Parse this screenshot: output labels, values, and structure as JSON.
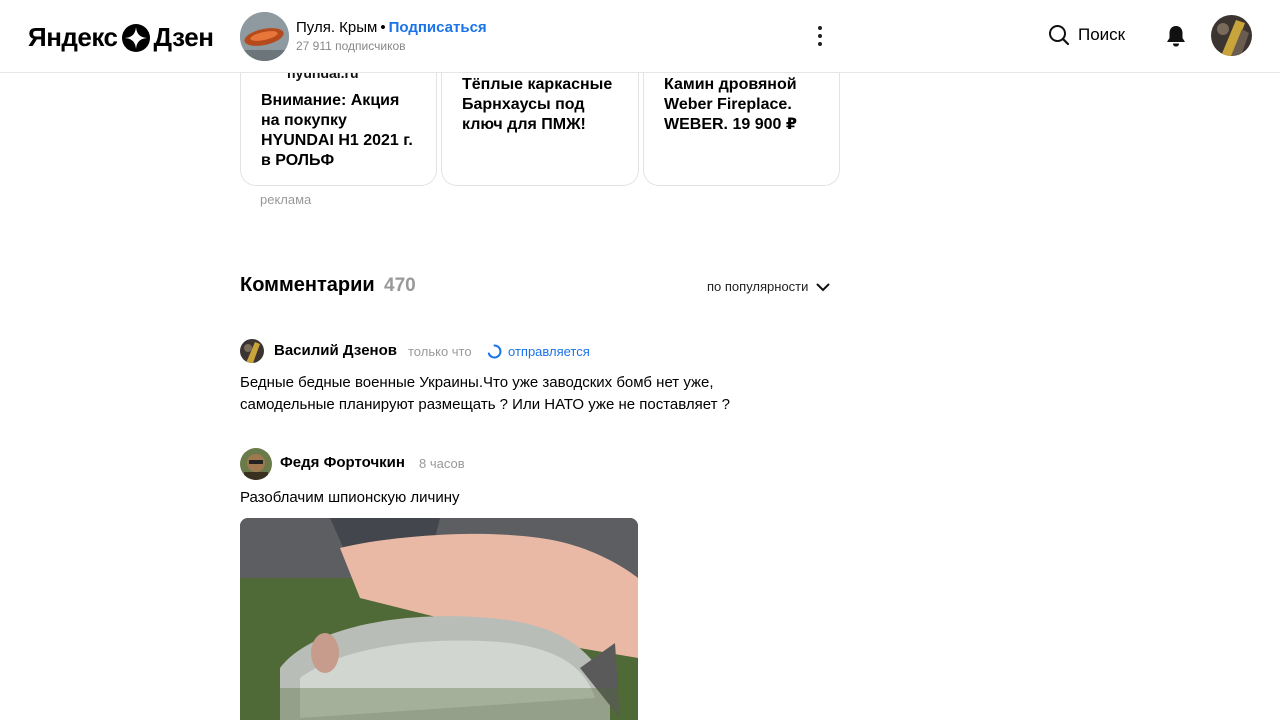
{
  "header": {
    "logo_text_left": "Яндекс",
    "logo_text_right": "Дзен",
    "channel_name": "Пуля. Крым",
    "channel_dot": "•",
    "subscribe_label": "Подписаться",
    "subscribers": "27 911 подписчиков",
    "search_label": "Поиск"
  },
  "ads": {
    "cards": [
      {
        "domain": "hyundai.ru",
        "title": "Внимание: Акция на покупку HYUNDAI H1 2021 г. в РОЛЬФ"
      },
      {
        "title": "Тёплые каркасные Барнхаусы под ключ для ПМЖ!"
      },
      {
        "title": "Камин дровяной Weber Fireplace. WEBER. 19 900 ₽"
      }
    ],
    "label": "реклама"
  },
  "comments": {
    "title": "Комментарии",
    "count": "470",
    "sort_label": "по популярности",
    "items": [
      {
        "author": "Василий Дзенов",
        "time": "только что",
        "status": "отправляется",
        "text": "Бедные бедные военные Украины.Что уже заводских бомб нет уже, самодельные планируют размещать ? Или НАТО уже не поставляет ?"
      },
      {
        "author": "Федя Форточкин",
        "time": "8 часов",
        "text": "Разоблачим шпионскую личину"
      }
    ]
  },
  "colors": {
    "accent": "#1a73e8",
    "muted": "#999999"
  }
}
